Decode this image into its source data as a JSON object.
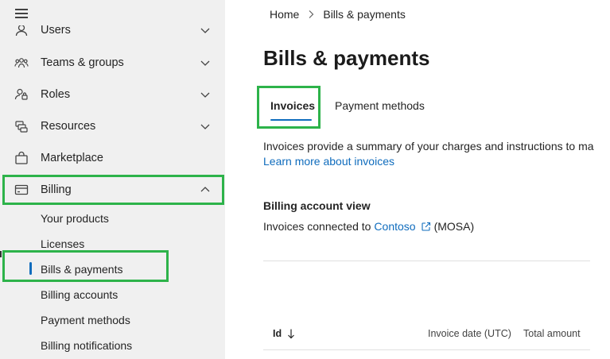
{
  "sidebar": {
    "items": [
      {
        "label": "Users",
        "icon": "person-icon",
        "expandable": true
      },
      {
        "label": "Teams & groups",
        "icon": "people-team-icon",
        "expandable": true
      },
      {
        "label": "Roles",
        "icon": "person-key-icon",
        "expandable": true
      },
      {
        "label": "Resources",
        "icon": "resources-icon",
        "expandable": true
      },
      {
        "label": "Marketplace",
        "icon": "shopping-bag-icon",
        "expandable": false
      },
      {
        "label": "Billing",
        "icon": "credit-card-icon",
        "expandable": true,
        "expanded": true
      }
    ],
    "billing_subitems": [
      {
        "label": "Your products"
      },
      {
        "label": "Licenses"
      },
      {
        "label": "Bills & payments",
        "active": true
      },
      {
        "label": "Billing accounts"
      },
      {
        "label": "Payment methods"
      },
      {
        "label": "Billing notifications"
      }
    ]
  },
  "breadcrumb": {
    "home": "Home",
    "current": "Bills & payments"
  },
  "page": {
    "title": "Bills & payments",
    "tabs": [
      {
        "label": "Invoices",
        "selected": true
      },
      {
        "label": "Payment methods",
        "selected": false
      }
    ],
    "description": "Invoices provide a summary of your charges and instructions to ma",
    "learn_more": "Learn more about invoices",
    "billing_view": {
      "heading": "Billing account view",
      "prefix": "Invoices connected to",
      "account_link": "Contoso",
      "suffix": "(MOSA)"
    },
    "table": {
      "columns": [
        "Id",
        "Invoice date (UTC)",
        "Total amount"
      ]
    }
  },
  "colors": {
    "accent": "#0f6cbd",
    "highlight": "#2db34a",
    "sidebar_bg": "#f0f0f0"
  }
}
